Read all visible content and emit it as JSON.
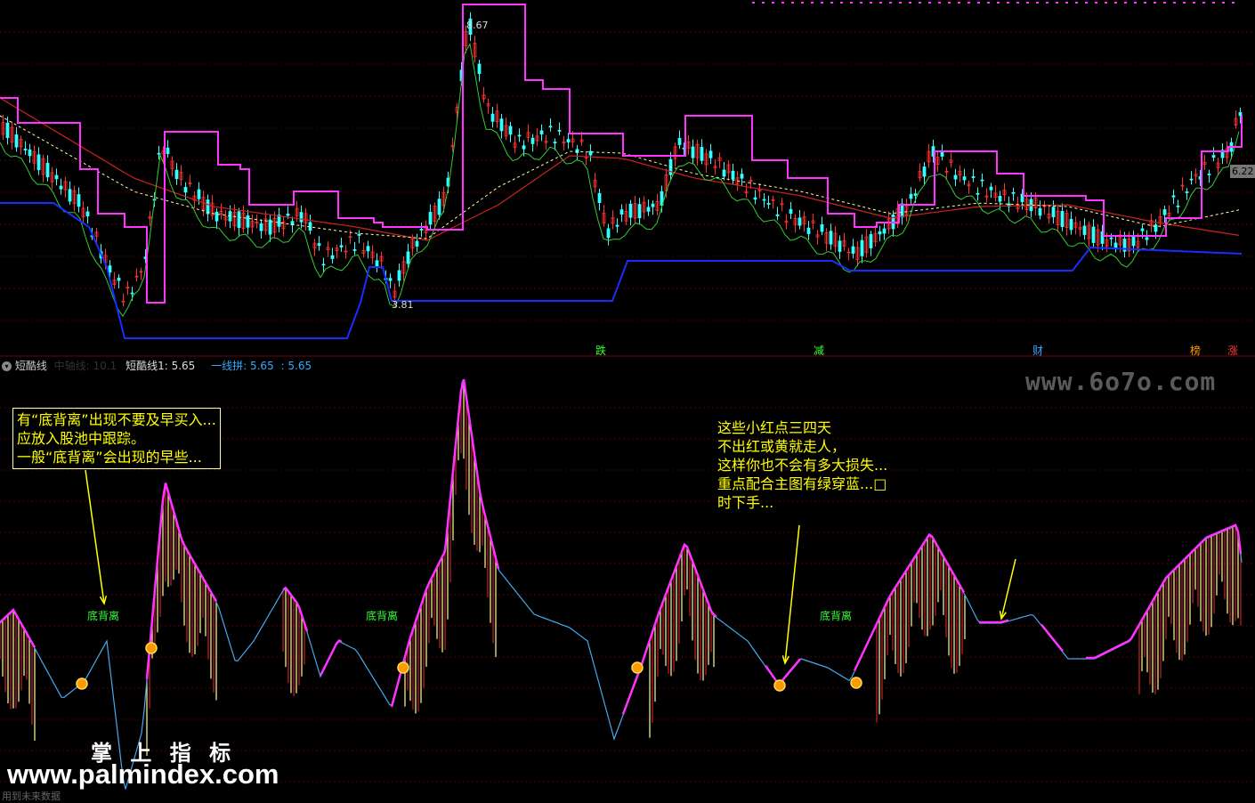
{
  "indicator_header": {
    "name": "短酷线",
    "hidden_label": "中轴线: 10.1",
    "value_label": "短酷线1: 5.65",
    "line_label": "一线拼: 5.65",
    "line_value": ": 5.65"
  },
  "top_panel": {
    "high_label": "8.67",
    "low_label": "3.81",
    "right_price": "6.22",
    "signals": [
      {
        "text": "跌",
        "color": "#33ff33"
      },
      {
        "text": "减",
        "color": "#33ff33"
      },
      {
        "text": "财",
        "color": "#33aaff"
      },
      {
        "text": "榜",
        "color": "#ff9900"
      },
      {
        "text": "涨",
        "color": "#ff3333"
      }
    ]
  },
  "bottom_panel": {
    "annotation_box": [
      "有“底背离”出现不要及早买入...",
      "应放入股池中跟踪。",
      "一般“底背离”会出现的早些..."
    ],
    "annotation_right": [
      "这些小红点三四天",
      "不出红或黄就走人，",
      "这样你也不会有多大损失...",
      "重点配合主图有绿穿蓝...□",
      " 时下手..."
    ],
    "divergence_labels": [
      "底背离",
      "底背离",
      "底背离"
    ],
    "footer_note": "用到未来数据"
  },
  "watermarks": {
    "site_top": "www.6o7o.com",
    "brand_cn": "掌 上 指 标",
    "site_bottom": "www.palmindex.com"
  },
  "colors": {
    "background": "#000000",
    "grid": "#5a0000",
    "up_candle": "#ff3333",
    "down_candle": "#33ffff",
    "magenta": "#ff33ff",
    "blue_line": "#1a2dff",
    "green_line": "#33cc33",
    "annotation": "#ffff00"
  }
}
